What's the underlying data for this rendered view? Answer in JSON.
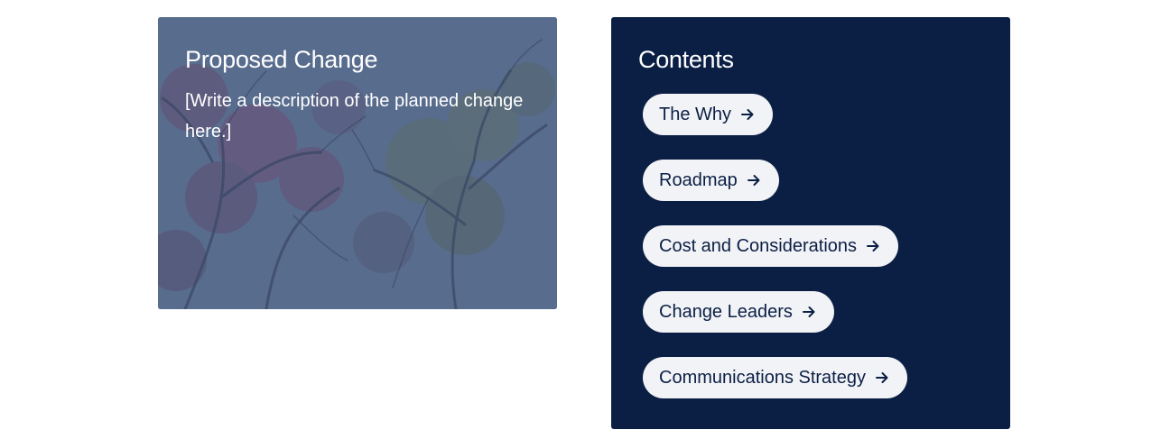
{
  "proposed_change": {
    "title": "Proposed Change",
    "description": "[Write a description of the planned change here.]"
  },
  "contents": {
    "title": "Contents",
    "items": [
      {
        "label": "The Why",
        "icon": "arrow-right-icon"
      },
      {
        "label": "Roadmap",
        "icon": "arrow-right-icon"
      },
      {
        "label": "Cost and Considerations",
        "icon": "arrow-right-icon"
      },
      {
        "label": "Change Leaders",
        "icon": "arrow-right-icon"
      },
      {
        "label": "Communications Strategy",
        "icon": "arrow-right-icon"
      }
    ]
  },
  "colors": {
    "panel_navy": "#0b1f45",
    "pill_background": "#f2f3f6",
    "card_overlay": "#46587d"
  }
}
